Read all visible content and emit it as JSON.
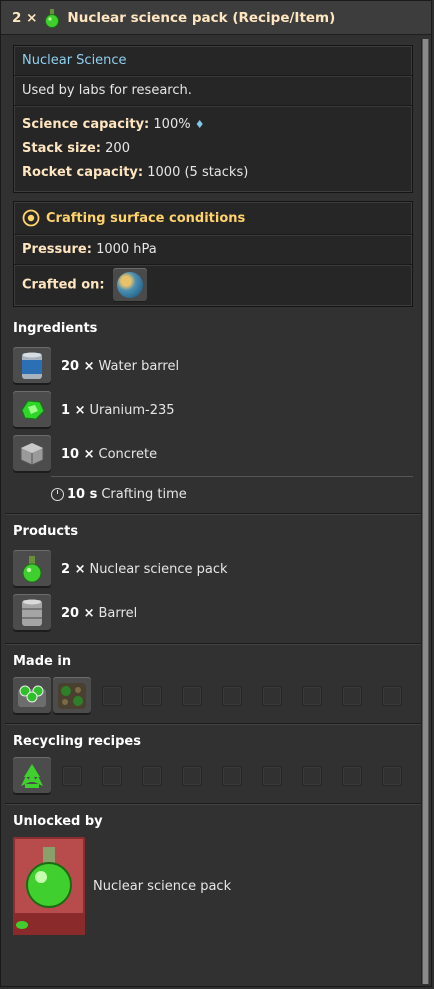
{
  "title": {
    "count": "2 ×",
    "name": "Nuclear science pack (Recipe/Item)",
    "icon": "nuclear-science-pack-icon"
  },
  "info": {
    "category": "Nuclear Science",
    "description": "Used by labs for research.",
    "science_capacity_label": "Science capacity:",
    "science_capacity_value": "100%",
    "stack_size_label": "Stack size:",
    "stack_size_value": "200",
    "rocket_capacity_label": "Rocket capacity:",
    "rocket_capacity_value": "1000 (5 stacks)"
  },
  "conditions": {
    "title": "Crafting surface conditions",
    "pressure_label": "Pressure:",
    "pressure_value": "1000 hPa",
    "crafted_on_label": "Crafted on:",
    "planet_icon": "nauvis-planet-icon"
  },
  "ingredients": {
    "title": "Ingredients",
    "items": [
      {
        "qty": "20 ×",
        "name": "Water barrel",
        "icon": "water-barrel-icon"
      },
      {
        "qty": "1 ×",
        "name": "Uranium-235",
        "icon": "uranium-235-icon"
      },
      {
        "qty": "10 ×",
        "name": "Concrete",
        "icon": "concrete-icon"
      }
    ],
    "time_value": "10 s",
    "time_label": "Crafting time"
  },
  "products": {
    "title": "Products",
    "items": [
      {
        "qty": "2 ×",
        "name": "Nuclear science pack",
        "icon": "nuclear-science-pack-icon"
      },
      {
        "qty": "20 ×",
        "name": "Barrel",
        "icon": "barrel-icon"
      }
    ]
  },
  "made_in": {
    "title": "Made in",
    "icons": [
      "assembling-machine-icon",
      "cryogenic-plant-icon"
    ]
  },
  "recycling": {
    "title": "Recycling recipes",
    "icons": [
      "recycling-icon"
    ]
  },
  "unlocked_by": {
    "title": "Unlocked by",
    "name": "Nuclear science pack",
    "icon": "nuclear-science-pack-technology-icon"
  },
  "colors": {
    "heading": "#ffe6c0",
    "category_link": "#8fd0ef",
    "conditions_title": "#ffd36b",
    "tech_bg": "#b84c4c"
  }
}
